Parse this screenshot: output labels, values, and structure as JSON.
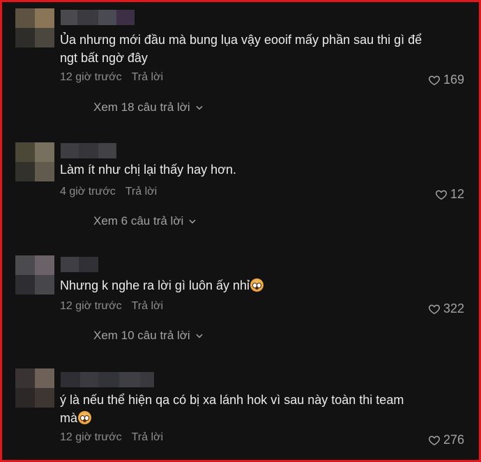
{
  "colors": {
    "frame": "#e3161c",
    "background": "#121212",
    "text": "#ececec",
    "muted": "#8e8e8e"
  },
  "comments": [
    {
      "text": "Ủa nhưng mới đầu mà bung lụa vậy eooif mấy phần sau thi gì để ngt bất ngờ đây",
      "time": "12 giờ trước",
      "reply_label": "Trả lời",
      "likes": "169",
      "view_replies": "Xem 18 câu trả lời"
    },
    {
      "text": "Làm ít như chị lại thấy hay hơn.",
      "time": "4 giờ trước",
      "reply_label": "Trả lời",
      "likes": "12",
      "view_replies": "Xem 6 câu trả lời"
    },
    {
      "text": "Nhưng k nghe ra lời gì luôn ấy nhỉ",
      "emoji": "pleading-face",
      "time": "12 giờ trước",
      "reply_label": "Trả lời",
      "likes": "322",
      "view_replies": "Xem 10 câu trả lời"
    },
    {
      "text": "ý là nếu thể hiện qa có bị xa lánh hok vì sau này toàn thi team mà",
      "emoji": "pleading-face",
      "time": "12 giờ trước",
      "reply_label": "Trả lời",
      "likes": "276"
    }
  ]
}
